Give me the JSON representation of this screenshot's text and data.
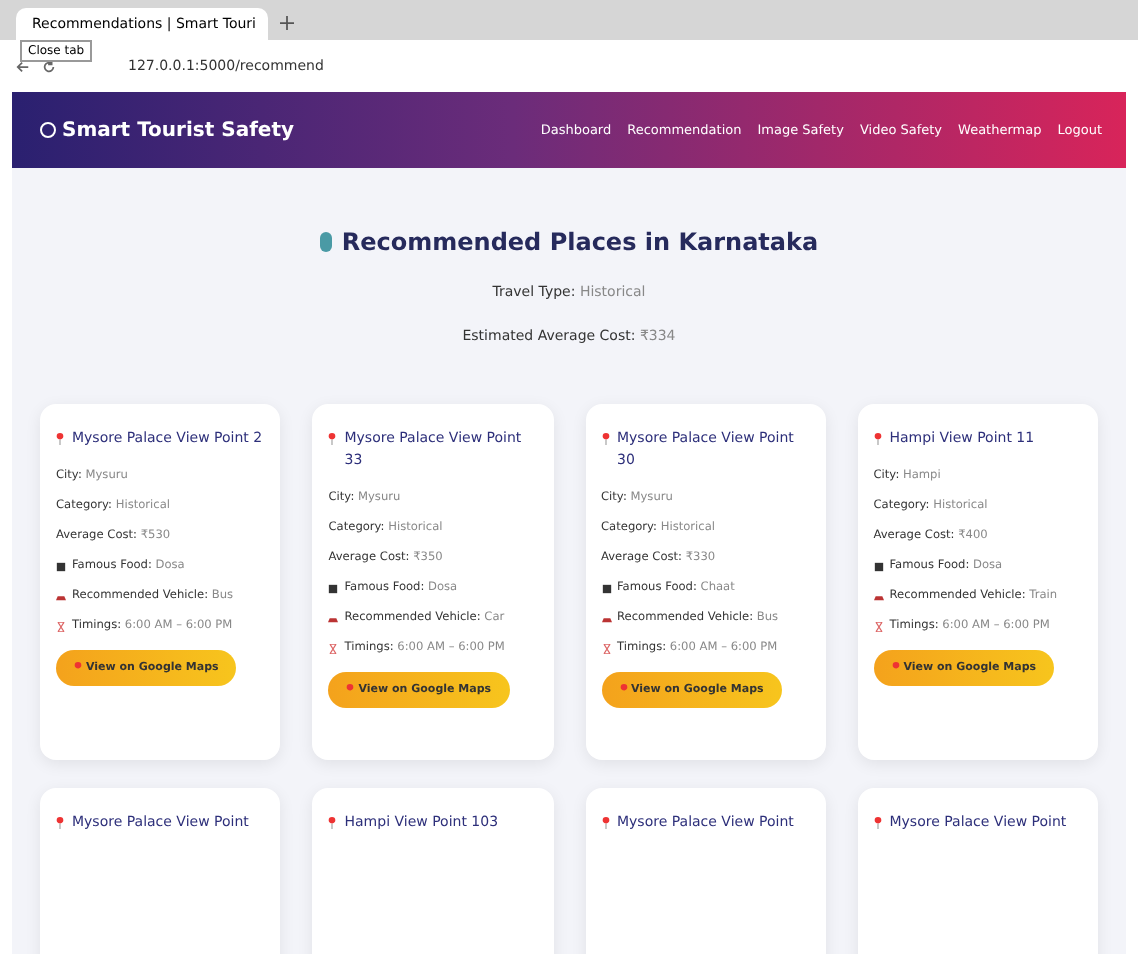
{
  "browser": {
    "tab_title": "Recommendations | Smart Touri",
    "tooltip": "Close tab",
    "address": "127.0.0.1:5000/recommend"
  },
  "navbar": {
    "brand": "Smart Tourist Safety",
    "links": [
      "Dashboard",
      "Recommendation",
      "Image Safety",
      "Video Safety",
      "Weathermap",
      "Logout"
    ]
  },
  "heading": "Recommended Places in Karnataka",
  "travel_type": {
    "label": "Travel Type:",
    "value": "Historical"
  },
  "average_cost": {
    "label": "Estimated Average Cost:",
    "value": "₹334"
  },
  "places": [
    {
      "name": "Mysore Palace View Point 2",
      "fields": [
        {
          "kind": "plain",
          "label": "City:",
          "value": "Mysuru"
        },
        {
          "kind": "plain",
          "label": "Category:",
          "value": "Historical"
        },
        {
          "kind": "plain",
          "label": "Average Cost:",
          "value": "₹530"
        },
        {
          "kind": "food",
          "label": "Famous Food:",
          "value": "Dosa"
        },
        {
          "kind": "vehicle",
          "label": "Recommended Vehicle:",
          "value": "Bus"
        },
        {
          "kind": "timings",
          "label": "Timings:",
          "value": "6:00 AM – 6:00 PM"
        }
      ],
      "button": "View on Google Maps"
    },
    {
      "name": "Mysore Palace View Point 33",
      "fields": [
        {
          "kind": "plain",
          "label": "City:",
          "value": "Mysuru"
        },
        {
          "kind": "plain",
          "label": "Category:",
          "value": "Historical"
        },
        {
          "kind": "plain",
          "label": "Average Cost:",
          "value": "₹350"
        },
        {
          "kind": "food",
          "label": "Famous Food:",
          "value": "Dosa"
        },
        {
          "kind": "vehicle",
          "label": "Recommended Vehicle:",
          "value": "Car"
        },
        {
          "kind": "timings",
          "label": "Timings:",
          "value": "6:00 AM – 6:00 PM"
        }
      ],
      "button": "View on Google Maps"
    },
    {
      "name": "Mysore Palace View Point 30",
      "fields": [
        {
          "kind": "plain",
          "label": "City:",
          "value": "Mysuru"
        },
        {
          "kind": "plain",
          "label": "Category:",
          "value": "Historical"
        },
        {
          "kind": "plain",
          "label": "Average Cost:",
          "value": "₹330"
        },
        {
          "kind": "food",
          "label": "Famous Food:",
          "value": "Chaat"
        },
        {
          "kind": "vehicle",
          "label": "Recommended Vehicle:",
          "value": "Bus"
        },
        {
          "kind": "timings",
          "label": "Timings:",
          "value": "6:00 AM – 6:00 PM"
        }
      ],
      "button": "View on Google Maps"
    },
    {
      "name": "Hampi View Point 11",
      "fields": [
        {
          "kind": "plain",
          "label": "City:",
          "value": "Hampi"
        },
        {
          "kind": "plain",
          "label": "Category:",
          "value": "Historical"
        },
        {
          "kind": "plain",
          "label": "Average Cost:",
          "value": "₹400"
        },
        {
          "kind": "food",
          "label": "Famous Food:",
          "value": "Dosa"
        },
        {
          "kind": "vehicle",
          "label": "Recommended Vehicle:",
          "value": "Train"
        },
        {
          "kind": "timings",
          "label": "Timings:",
          "value": "6:00 AM – 6:00 PM"
        }
      ],
      "button": "View on Google Maps"
    },
    {
      "name": "Mysore Palace View Point"
    },
    {
      "name": "Hampi View Point 103"
    },
    {
      "name": "Mysore Palace View Point"
    },
    {
      "name": "Mysore Palace View Point"
    }
  ]
}
